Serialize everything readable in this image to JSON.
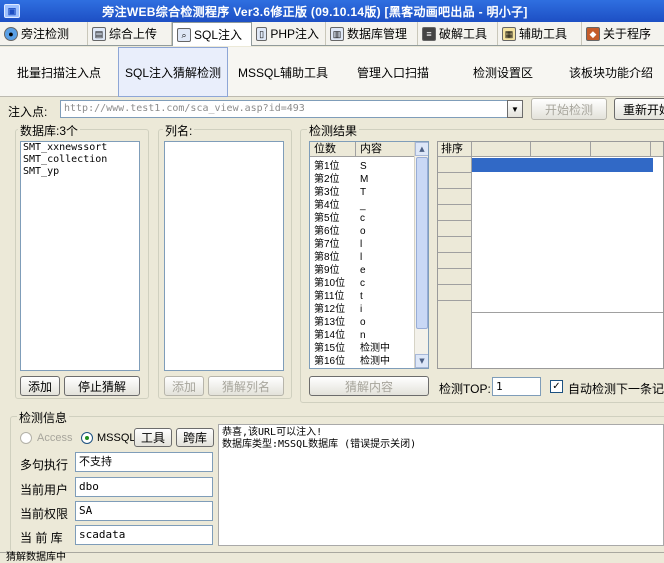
{
  "window": {
    "title": "旁注WEB综合检测程序 Ver3.6修正版 (09.10.14版) [黑客动画吧出品 - 明小子]"
  },
  "main_tabs": [
    {
      "label": "旁注检测",
      "icon": "globe-icon"
    },
    {
      "label": "综合上传",
      "icon": "upload-icon"
    },
    {
      "label": "SQL注入",
      "icon": "sql-icon"
    },
    {
      "label": "PHP注入",
      "icon": "php-icon"
    },
    {
      "label": "数据库管理",
      "icon": "database-icon"
    },
    {
      "label": "破解工具",
      "icon": "crack-icon"
    },
    {
      "label": "辅助工具",
      "icon": "tools-icon"
    },
    {
      "label": "关于程序",
      "icon": "about-icon"
    }
  ],
  "sub_tabs": [
    "批量扫描注入点",
    "SQL注入猜解检测",
    "MSSQL辅助工具",
    "管理入口扫描",
    "检测设置区",
    "该板块功能介绍"
  ],
  "injection": {
    "label": "注入点:",
    "url": "http://www.test1.com/sca_view.asp?id=493",
    "start_button": "开始检测",
    "restart_button": "重新开始"
  },
  "database": {
    "label": "数据库:3个",
    "items": [
      "SMT_xxnewssort",
      "SMT_collection",
      "SMT_yp"
    ],
    "add_button": "添加",
    "stop_button": "停止猜解"
  },
  "columns": {
    "label": "列名:",
    "add_button": "添加",
    "guess_button": "猜解列名"
  },
  "results": {
    "label": "检测结果",
    "headers": [
      "位数",
      "内容"
    ],
    "rows": [
      [
        "第1位",
        "S"
      ],
      [
        "第2位",
        "M"
      ],
      [
        "第3位",
        "T"
      ],
      [
        "第4位",
        "_"
      ],
      [
        "第5位",
        "c"
      ],
      [
        "第6位",
        "o"
      ],
      [
        "第7位",
        "l"
      ],
      [
        "第8位",
        "l"
      ],
      [
        "第9位",
        "e"
      ],
      [
        "第10位",
        "c"
      ],
      [
        "第11位",
        "t"
      ],
      [
        "第12位",
        "i"
      ],
      [
        "第13位",
        "o"
      ],
      [
        "第14位",
        "n"
      ],
      [
        "第15位",
        "检测中"
      ],
      [
        "第16位",
        "检测中"
      ]
    ],
    "guess_content_button": "猜解内容",
    "sort_header": "排序",
    "top_label": "检测TOP:",
    "top_value": "1",
    "auto_label": "自动检测下一条记"
  },
  "info": {
    "label": "检测信息",
    "access_label": "Access",
    "mssql_label": "MSSQL",
    "tools_button": "工具",
    "crosslib_button": "跨库",
    "fields": [
      {
        "label": "多句执行",
        "value": "不支持"
      },
      {
        "label": "当前用户",
        "value": "dbo"
      },
      {
        "label": "当前权限",
        "value": "SA"
      },
      {
        "label": "当 前 库",
        "value": "scadata"
      }
    ],
    "message_line1": "恭喜,该URL可以注入!",
    "message_line2": "数据库类型:MSSQL数据库 (错误提示关闭)"
  },
  "status": {
    "text": "猜解数据库中"
  }
}
